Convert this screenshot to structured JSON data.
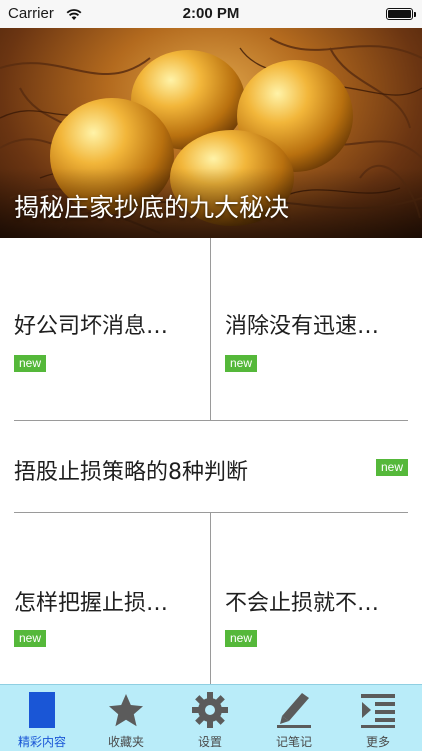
{
  "status_bar": {
    "carrier": "Carrier",
    "time": "2:00 PM",
    "battery_level": 1.0
  },
  "banner": {
    "title": "揭秘庄家抄底的九大秘决"
  },
  "articles": [
    {
      "title": "好公司坏消息…",
      "badge": "new"
    },
    {
      "title": "消除没有迅速…",
      "badge": "new"
    },
    {
      "title": "捂股止损策略的8种判断",
      "badge": "new"
    },
    {
      "title": "怎样把握止损…",
      "badge": "new"
    },
    {
      "title": "不会止损就不…",
      "badge": "new"
    }
  ],
  "tabbar": {
    "accent_color": "#1a56d6",
    "tabs": [
      {
        "label": "精彩内容",
        "icon": "page-icon",
        "active": true
      },
      {
        "label": "收藏夹",
        "icon": "star-icon",
        "active": false
      },
      {
        "label": "设置",
        "icon": "gear-icon",
        "active": false
      },
      {
        "label": "记笔记",
        "icon": "pen-icon",
        "active": false
      },
      {
        "label": "更多",
        "icon": "list-icon",
        "active": false
      }
    ]
  }
}
